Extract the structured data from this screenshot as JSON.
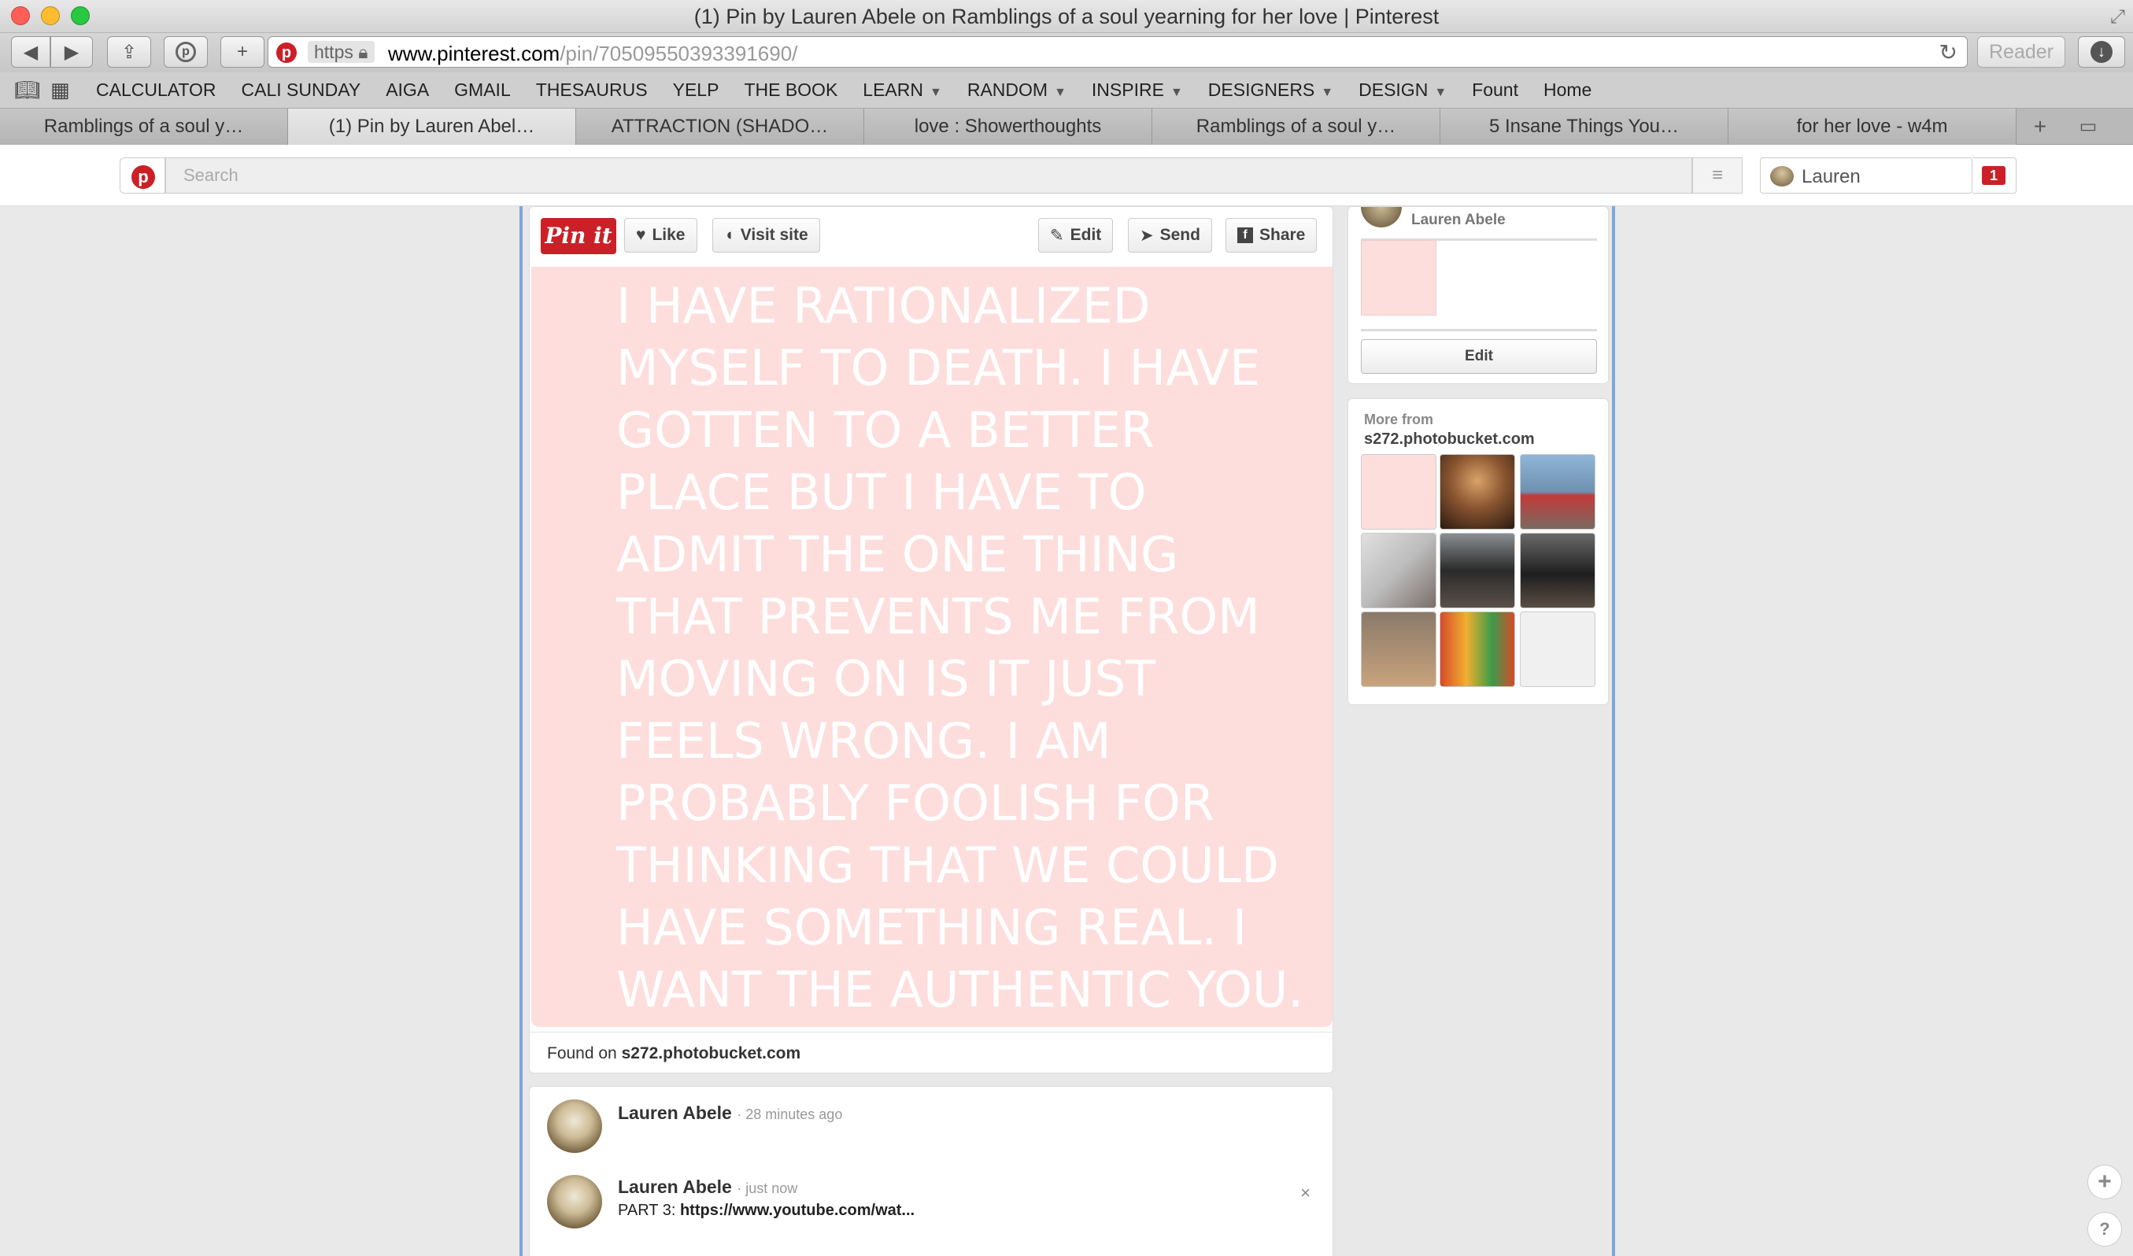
{
  "window": {
    "title": "(1) Pin by Lauren Abele on Ramblings of a soul yearning for her love | Pinterest",
    "colors": {
      "close": "#ff5f57",
      "minimize": "#febc2e",
      "zoom": "#28c840"
    }
  },
  "toolbar": {
    "url_scheme": "https",
    "url_host": "www.pinterest.com",
    "url_path": "/pin/70509550393391690/",
    "reader_label": "Reader",
    "back_icon": "back-icon",
    "forward_icon": "forward-icon"
  },
  "bookmarks": [
    {
      "label": "CALCULATOR",
      "menu": false
    },
    {
      "label": "CALI SUNDAY",
      "menu": false
    },
    {
      "label": "AIGA",
      "menu": false
    },
    {
      "label": "GMAIL",
      "menu": false
    },
    {
      "label": "THESAURUS",
      "menu": false
    },
    {
      "label": "YELP",
      "menu": false
    },
    {
      "label": "THE BOOK",
      "menu": false
    },
    {
      "label": "LEARN",
      "menu": true
    },
    {
      "label": "RANDOM",
      "menu": true
    },
    {
      "label": "INSPIRE",
      "menu": true
    },
    {
      "label": "DESIGNERS",
      "menu": true
    },
    {
      "label": "DESIGN",
      "menu": true
    },
    {
      "label": "Fount",
      "menu": false
    },
    {
      "label": "Home",
      "menu": false
    }
  ],
  "tabs": [
    {
      "label": "Ramblings of a soul y…",
      "active": false
    },
    {
      "label": "(1) Pin by Lauren Abel…",
      "active": true
    },
    {
      "label": "ATTRACTION (SHADO…",
      "active": false
    },
    {
      "label": "love : Showerthoughts",
      "active": false
    },
    {
      "label": "Ramblings of a soul y…",
      "active": false
    },
    {
      "label": "5 Insane Things You…",
      "active": false
    },
    {
      "label": "for her love - w4m",
      "active": false
    }
  ],
  "header": {
    "search_placeholder": "Search",
    "user_name": "Lauren",
    "notification_count": "1",
    "brand_color": "#cb2027"
  },
  "pin": {
    "pinit_label": "Pin it",
    "like_label": "Like",
    "visit_label": "Visit site",
    "edit_label": "Edit",
    "send_label": "Send",
    "share_label": "Share",
    "quote": "I have rationalized myself to death. I have gotten to a better place but I have to admit the one thing that prevents me from moving on is it just feels wrong. I am probably foolish for thinking that we could have something real. I want the authentic you.",
    "image_bg": "#fddedd",
    "found_prefix": "Found on ",
    "found_source": "s272.photobucket.com"
  },
  "comments": [
    {
      "name": "Lauren Abele",
      "time": "· 28 minutes ago",
      "prefix": "",
      "text": ""
    },
    {
      "name": "Lauren Abele",
      "time": "· just now",
      "prefix": "PART 3: ",
      "text": "https://www.youtube.com/wat..."
    }
  ],
  "sidebar": {
    "board_owner": "Lauren Abele",
    "edit_label": "Edit",
    "more_label": "More from",
    "more_source": "s272.photobucket.com"
  }
}
